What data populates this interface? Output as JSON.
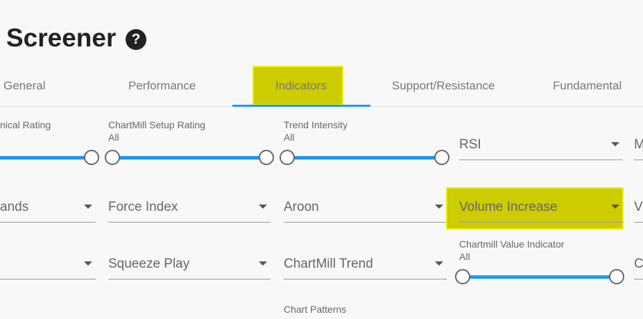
{
  "page": {
    "title": "Screener",
    "help_icon": "?"
  },
  "tabs": [
    {
      "label": "General"
    },
    {
      "label": "Performance"
    },
    {
      "label": "Indicators",
      "active": true,
      "highlighted": true
    },
    {
      "label": "Support/Resistance"
    },
    {
      "label": "Fundamental"
    }
  ],
  "filters": {
    "technical_rating": {
      "label": "nical Rating"
    },
    "setup_rating": {
      "label": "ChartMill Setup Rating",
      "value": "All"
    },
    "trend_intensity": {
      "label": "Trend Intensity",
      "value": "All"
    },
    "rsi": {
      "value": "RSI"
    },
    "col5_row1": {
      "value": "M"
    },
    "bands": {
      "value": "ands"
    },
    "force_index": {
      "value": "Force Index"
    },
    "aroon": {
      "value": "Aroon"
    },
    "volume_increase": {
      "value": "Volume Increase",
      "highlighted": true
    },
    "col5_row2": {
      "value": "V"
    },
    "col1_row3": {
      "value": ""
    },
    "squeeze_play": {
      "value": "Squeeze Play"
    },
    "chartmill_trend": {
      "value": "ChartMill Trend"
    },
    "value_indicator": {
      "label": "Chartmill Value Indicator",
      "value": "All"
    },
    "col5_row3": {
      "value": "C"
    },
    "chart_patterns": {
      "label": "Chart Patterns"
    }
  },
  "colors": {
    "accent": "#2196f3",
    "highlight": "#cccc00",
    "highlight_border": "#eded00"
  }
}
